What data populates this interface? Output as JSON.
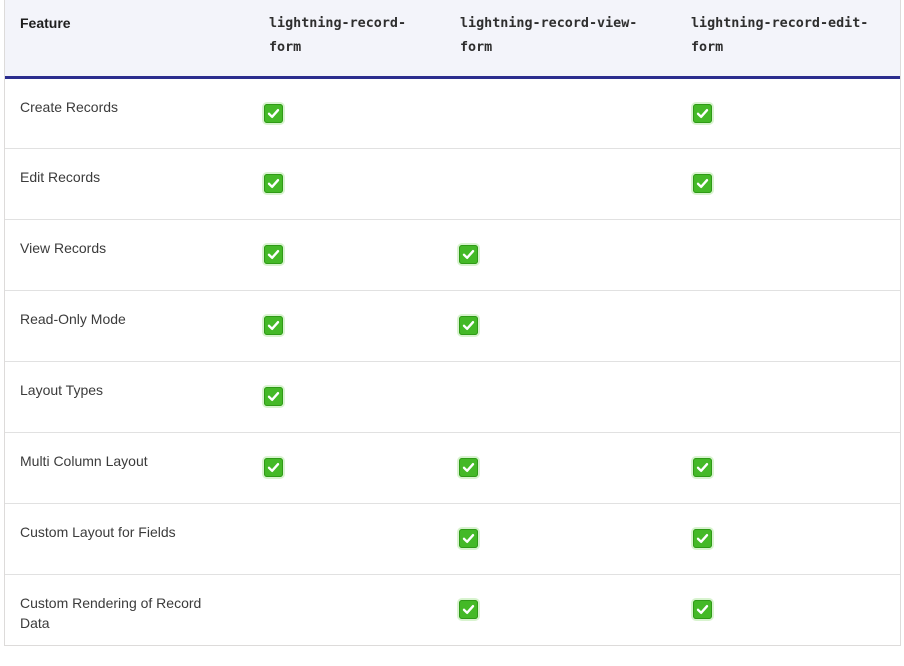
{
  "table": {
    "headers": [
      "Feature",
      "lightning-record-form",
      "lightning-record-view-form",
      "lightning-record-edit-form"
    ],
    "header_display": {
      "col2": [
        "lightning-record-",
        "form"
      ],
      "col3": [
        "lightning-record-view-",
        "form"
      ],
      "col4": [
        "lightning-record-edit-",
        "form"
      ]
    },
    "rows": [
      {
        "feature": "Create Records",
        "record_form": true,
        "view_form": false,
        "edit_form": true
      },
      {
        "feature": "Edit Records",
        "record_form": true,
        "view_form": false,
        "edit_form": true
      },
      {
        "feature": "View Records",
        "record_form": true,
        "view_form": true,
        "edit_form": false
      },
      {
        "feature": "Read-Only Mode",
        "record_form": true,
        "view_form": true,
        "edit_form": false
      },
      {
        "feature": "Layout Types",
        "record_form": true,
        "view_form": false,
        "edit_form": false
      },
      {
        "feature": "Multi Column Layout",
        "record_form": true,
        "view_form": true,
        "edit_form": true
      },
      {
        "feature": "Custom Layout for Fields",
        "record_form": false,
        "view_form": true,
        "edit_form": true
      },
      {
        "feature": "Custom Rendering of Record Data",
        "record_form": false,
        "view_form": true,
        "edit_form": true
      }
    ]
  },
  "icons": {
    "check": "check-mark-button-icon"
  },
  "colors": {
    "header_bg": "#f3f4fa",
    "header_rule": "#2b2d8e",
    "check_green": "#44b927"
  }
}
